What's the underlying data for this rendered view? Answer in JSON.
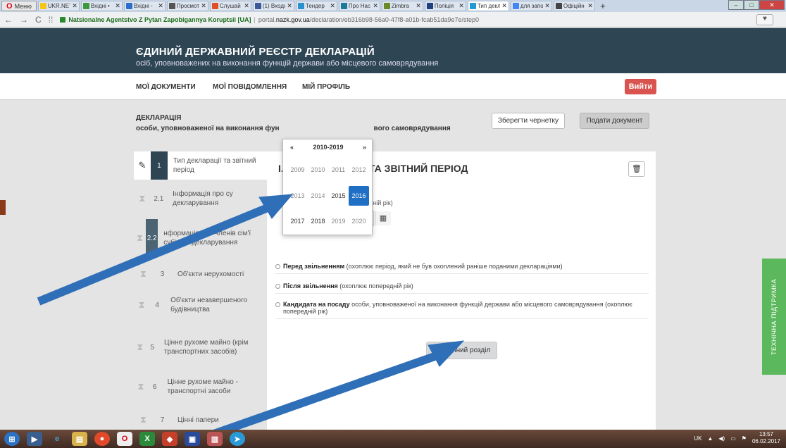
{
  "browser": {
    "menu_label": "Меню",
    "tabs": [
      {
        "title": "UKR.NET",
        "color": "#f5c518",
        "active": false
      },
      {
        "title": "Вхідні • ",
        "color": "#3a9a3a",
        "active": false
      },
      {
        "title": "Вхідні - ",
        "color": "#2a6ecc",
        "active": false
      },
      {
        "title": "Просмот",
        "color": "#555555",
        "active": false
      },
      {
        "title": "Слушай",
        "color": "#e05020",
        "active": false
      },
      {
        "title": "(1) Входя",
        "color": "#3b5998",
        "active": false
      },
      {
        "title": "Тендер",
        "color": "#2a90d0",
        "active": false
      },
      {
        "title": "Про Нас",
        "color": "#1a7a9a",
        "active": false
      },
      {
        "title": "Zimbra",
        "color": "#6a8a2a",
        "active": false
      },
      {
        "title": "Поліція",
        "color": "#1f3f7f",
        "active": false
      },
      {
        "title": "Тип декл",
        "color": "#1f9ad6",
        "active": true
      },
      {
        "title": "для запо",
        "color": "#4285f4",
        "active": false
      },
      {
        "title": "Офіційн",
        "color": "#444444",
        "active": false
      }
    ],
    "cert_org": "Natsionalne Agentstvo Z Pytan Zapobigannya Koruptsii [UA]",
    "url_sep": "|",
    "url_pre": "portal.",
    "url_domain": "nazk.gov.ua",
    "url_path": "/declaration/eb316b98-56a0-47f8-a01b-fcab51da9e7e/step0"
  },
  "header": {
    "title": "ЄДИНИЙ ДЕРЖАВНИЙ РЕЄСТР ДЕКЛАРАЦІЙ",
    "subtitle": "осіб, уповноважених на виконання функцій держави або місцевого самоврядування"
  },
  "nav": {
    "docs": "МОЇ ДОКУМЕНТИ",
    "messages": "МОЇ ПОВІДОМЛЕННЯ",
    "profile": "МІЙ ПРОФІЛЬ",
    "logout": "Вийти"
  },
  "declaration": {
    "title": "ДЕКЛАРАЦІЯ",
    "subtitle_a": "особи, уповноваженої на виконання фун",
    "subtitle_b": "вого самоврядування",
    "save_draft": "Зберегти чернетку",
    "submit": "Подати документ"
  },
  "steps": [
    {
      "num": "1",
      "label": "Тип декларації та звітний період",
      "state": "active"
    },
    {
      "num": "2.1",
      "label": "Інформація про су декларування",
      "state": "normal"
    },
    {
      "num": "2.2",
      "label": "нформація про членів сім'ї суб'єкта декларування",
      "state": "dim"
    },
    {
      "num": "3",
      "label": "Об'єкти нерухомості",
      "state": "normal"
    },
    {
      "num": "4",
      "label": "Об'єкти незавершеного будівництва",
      "state": "normal"
    },
    {
      "num": "5",
      "label": "Цінне рухоме майно (крім транспортних засобів)",
      "state": "normal"
    },
    {
      "num": "6",
      "label": "Цінне рухоме майно - транспортні засоби",
      "state": "normal"
    },
    {
      "num": "7",
      "label": "Цінні папери",
      "state": "normal"
    }
  ],
  "main": {
    "section_prefix": "І.",
    "section_title": "ТА ЗВІТНИЙ ПЕРІОД",
    "year_hint": "дній рік)",
    "year_value": "2016",
    "options": [
      {
        "bold": "Перед звільненням",
        "text": " (охоплює період, який не був охоплений раніше поданими деклараціями)"
      },
      {
        "bold": "Після звільнення",
        "text": " (охоплює попередній рік)"
      },
      {
        "bold": "Кандидата на посаду",
        "text": " особи, уповноваженої на виконання функцій держави або місцевого самоврядування (охоплює попередній рік)"
      }
    ],
    "next_button": "Наступний розділ"
  },
  "datepicker": {
    "prev": "«",
    "range": "2010-2019",
    "next": "»",
    "rows": [
      [
        "2009",
        "2010",
        "2011",
        "2012"
      ],
      [
        "2013",
        "2014",
        "2015",
        "2016"
      ],
      [
        "2017",
        "2018",
        "2019",
        "2020"
      ]
    ],
    "selected": "2016"
  },
  "support_tab": "ТЕХНІЧНА ПІДТРИМКА",
  "taskbar": {
    "lang": "UK",
    "time": "13:57",
    "date": "06.02.2017"
  },
  "colors": {
    "header_bg": "#2e4554",
    "logout_bg": "#d9534f",
    "support_bg": "#5cb85c",
    "selected_year": "#1f6fc5",
    "arrow": "#2f6fb8"
  }
}
